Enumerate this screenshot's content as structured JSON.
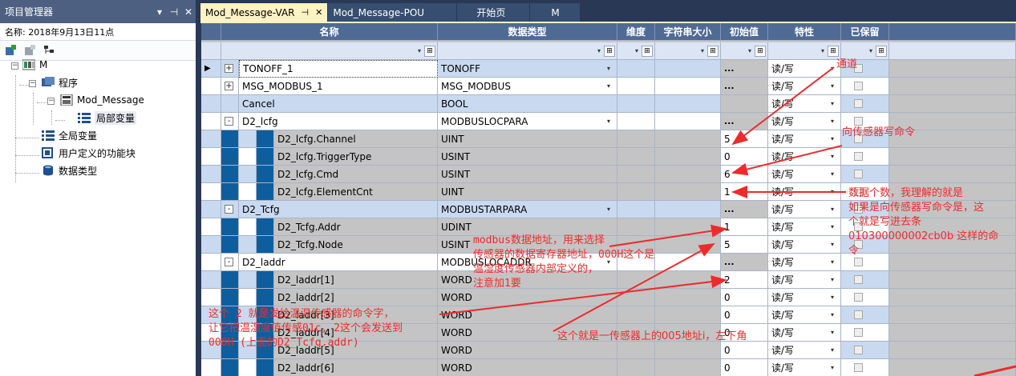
{
  "left_panel": {
    "title": "项目管理器",
    "title_controls": [
      "▾",
      "⊣",
      "✕"
    ],
    "info": "名称:  2018年9月13日11点",
    "tree": {
      "root": "M",
      "program": "程序",
      "pou": "Mod_Message",
      "local_vars": "局部变量",
      "global_vars": "全局变量",
      "user_fb": "用户定义的功能块",
      "data_types": "数据类型"
    }
  },
  "tabs": [
    {
      "label": "Mod_Message-VAR",
      "active": true,
      "pin": "⊣",
      "close": "✕"
    },
    {
      "label": "Mod_Message-POU",
      "active": false
    },
    {
      "label": "开始页",
      "active": false
    },
    {
      "label": "M",
      "active": false
    }
  ],
  "grid": {
    "headers": [
      "名称",
      "数据类型",
      "维度",
      "字符串大小",
      "初始值",
      "特性",
      "已保留"
    ],
    "rows": [
      {
        "expand": "+",
        "indent": 0,
        "name": "TONOFF_1",
        "type": "TONOFF",
        "init": "...",
        "attr": "读/写",
        "selected": true
      },
      {
        "expand": "+",
        "indent": 0,
        "name": "MSG_MODBUS_1",
        "type": "MSG_MODBUS",
        "init": "...",
        "attr": "读/写"
      },
      {
        "expand": "",
        "indent": 0,
        "name": "Cancel",
        "type": "BOOL",
        "init": "",
        "attr": "读/写"
      },
      {
        "expand": "-",
        "indent": 0,
        "name": "D2_lcfg",
        "type": "MODBUSLOCPARA",
        "init": "...",
        "attr": "读/写"
      },
      {
        "expand": "",
        "indent": 1,
        "name": "D2_lcfg.Channel",
        "type": "UINT",
        "init": "5",
        "attr": "读/写"
      },
      {
        "expand": "",
        "indent": 1,
        "name": "D2_lcfg.TriggerType",
        "type": "USINT",
        "init": "0",
        "attr": "读/写"
      },
      {
        "expand": "",
        "indent": 1,
        "name": "D2_lcfg.Cmd",
        "type": "USINT",
        "init": "6",
        "attr": "读/写"
      },
      {
        "expand": "",
        "indent": 1,
        "name": "D2_lcfg.ElementCnt",
        "type": "UINT",
        "init": "1",
        "attr": "读/写"
      },
      {
        "expand": "-",
        "indent": 0,
        "name": "D2_Tcfg",
        "type": "MODBUSTARPARA",
        "init": "...",
        "attr": "读/写"
      },
      {
        "expand": "",
        "indent": 1,
        "name": "D2_Tcfg.Addr",
        "type": "UDINT",
        "init": "1",
        "attr": "读/写"
      },
      {
        "expand": "",
        "indent": 1,
        "name": "D2_Tcfg.Node",
        "type": "USINT",
        "init": "5",
        "attr": "读/写"
      },
      {
        "expand": "-",
        "indent": 0,
        "name": "D2_laddr",
        "type": "MODBUSLOCADDR",
        "init": "...",
        "attr": "读/写"
      },
      {
        "expand": "",
        "indent": 1,
        "name": "D2_laddr[1]",
        "type": "WORD",
        "init": "2",
        "attr": "读/写"
      },
      {
        "expand": "",
        "indent": 1,
        "name": "D2_laddr[2]",
        "type": "WORD",
        "init": "0",
        "attr": "读/写"
      },
      {
        "expand": "",
        "indent": 1,
        "name": "D2_laddr[3]",
        "type": "WORD",
        "init": "0",
        "attr": "读/写"
      },
      {
        "expand": "",
        "indent": 1,
        "name": "D2_laddr[4]",
        "type": "WORD",
        "init": "0",
        "attr": "读/写"
      },
      {
        "expand": "",
        "indent": 1,
        "name": "D2_laddr[5]",
        "type": "WORD",
        "init": "0",
        "attr": "读/写"
      },
      {
        "expand": "",
        "indent": 1,
        "name": "D2_laddr[6]",
        "type": "WORD",
        "init": "0",
        "attr": "读/写"
      }
    ]
  },
  "annotations": {
    "channel": "通道",
    "cmd": "向传感器写命令",
    "count": "数据个数，我理解的就是\n如果是向传感器写命令是，这\n个就是写进去条\n010300000002cb0b 这样的命\n令",
    "modbus_addr": "modbus数据地址，用来选择\n传感器的数据寄存器地址，000H这个是\n温湿度传感器内部定义的，\n注意加1要",
    "laddr": "这个 2 就是发给温湿传感器的命令字，\n让它把温湿度值传感01c, 2这个会发送到\n000H (上面的D2_Tcfg.addr)",
    "node": "这个就是一传感器上的005地址i，左下角"
  },
  "colors": {
    "annotation": "#ee2b2b",
    "header": "#4f6a95",
    "tab_active": "#fff2c3"
  }
}
